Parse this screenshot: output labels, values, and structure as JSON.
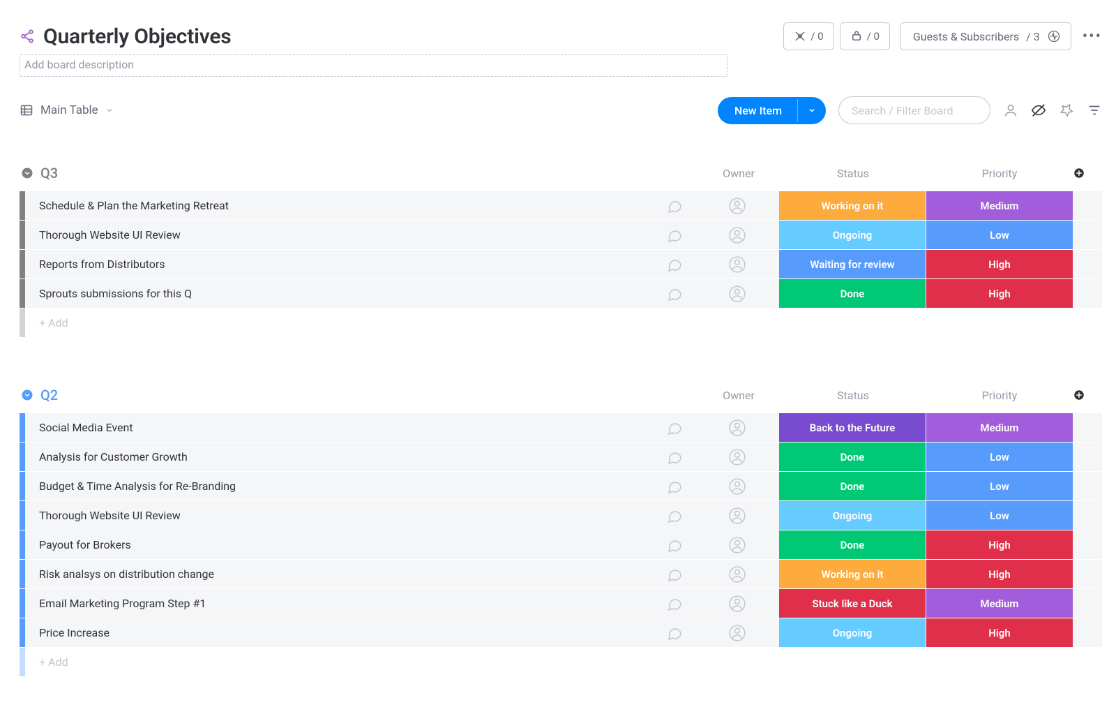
{
  "header": {
    "title": "Quarterly Objectives",
    "desc_placeholder": "Add board description",
    "integration1_count": "/ 0",
    "integration2_count": "/ 0",
    "guests_label": "Guests & Subscribers",
    "guests_count": "/ 3"
  },
  "toolbar": {
    "view_name": "Main Table",
    "new_item_label": "New Item",
    "search_placeholder": "Search / Filter Board"
  },
  "columns": {
    "owner": "Owner",
    "status": "Status",
    "priority": "Priority"
  },
  "add_row_label": "+ Add",
  "status_colors": {
    "Working on it": "#fdab3d",
    "Ongoing": "#66ccff",
    "Waiting for review": "#579bfc",
    "Done": "#00c875",
    "Back to the Future": "#784bd1",
    "Stuck like a Duck": "#df2f4a"
  },
  "priority_colors": {
    "Low": "#579bfc",
    "Medium": "#a25ddc",
    "High": "#df2f4a"
  },
  "groups": [
    {
      "title": "Q3",
      "color": "#808080",
      "rows": [
        {
          "name": "Schedule & Plan the Marketing Retreat",
          "status": "Working on it",
          "priority": "Medium"
        },
        {
          "name": "Thorough Website UI Review",
          "status": "Ongoing",
          "priority": "Low"
        },
        {
          "name": "Reports from Distributors",
          "status": "Waiting for review",
          "priority": "High"
        },
        {
          "name": "Sprouts submissions for this Q",
          "status": "Done",
          "priority": "High"
        }
      ]
    },
    {
      "title": "Q2",
      "color": "#579bfc",
      "rows": [
        {
          "name": "Social Media Event",
          "status": "Back to the Future",
          "priority": "Medium"
        },
        {
          "name": "Analysis for Customer Growth",
          "status": "Done",
          "priority": "Low"
        },
        {
          "name": "Budget & Time Analysis for Re-Branding",
          "status": "Done",
          "priority": "Low"
        },
        {
          "name": "Thorough Website UI Review",
          "status": "Ongoing",
          "priority": "Low"
        },
        {
          "name": "Payout for Brokers",
          "status": "Done",
          "priority": "High"
        },
        {
          "name": "Risk analsys on distribution change",
          "status": "Working on it",
          "priority": "High"
        },
        {
          "name": "Email Marketing Program Step #1",
          "status": "Stuck like a Duck",
          "priority": "Medium"
        },
        {
          "name": "Price Increase",
          "status": "Ongoing",
          "priority": "High"
        }
      ]
    }
  ]
}
